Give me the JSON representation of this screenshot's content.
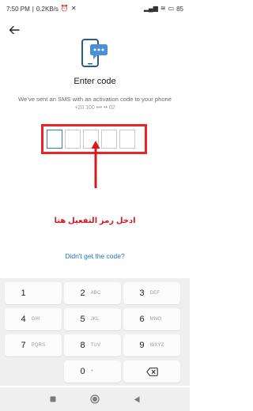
{
  "status_bar": {
    "time": "7:50 PM",
    "data_speed": "0.2KB/s",
    "battery": "85"
  },
  "header": {
    "title": "Enter code",
    "subtitle": "We’ve sent an SMS with an activation code to your phone",
    "subtitle_cut": "+20 100 ••• •• 02"
  },
  "code_input": {
    "cells": 5,
    "active_index": 0
  },
  "annotation": {
    "text": "ادخل رمز التفعيل هنا",
    "color": "#d31b1f"
  },
  "resend": {
    "label": "Didn't get the code?"
  },
  "keypad": {
    "keys": [
      {
        "digit": "1",
        "letters": ""
      },
      {
        "digit": "2",
        "letters": "ABC"
      },
      {
        "digit": "3",
        "letters": "DEF"
      },
      {
        "digit": "4",
        "letters": "GHI"
      },
      {
        "digit": "5",
        "letters": "JKL"
      },
      {
        "digit": "6",
        "letters": "MNO"
      },
      {
        "digit": "7",
        "letters": "PQRS"
      },
      {
        "digit": "8",
        "letters": "TUV"
      },
      {
        "digit": "9",
        "letters": "WXYZ"
      },
      {
        "digit": "0",
        "letters": "+"
      }
    ]
  },
  "icons": {
    "back": "arrow-left-icon",
    "phone": "phone-sms-icon",
    "backspace": "backspace-icon",
    "nav_recent": "square-icon",
    "nav_home": "circle-icon",
    "nav_back": "triangle-icon"
  },
  "colors": {
    "accent": "#3f7ab8",
    "link": "#1f73c6",
    "highlight": "#e8262a",
    "keypad_bg": "#efefef"
  }
}
